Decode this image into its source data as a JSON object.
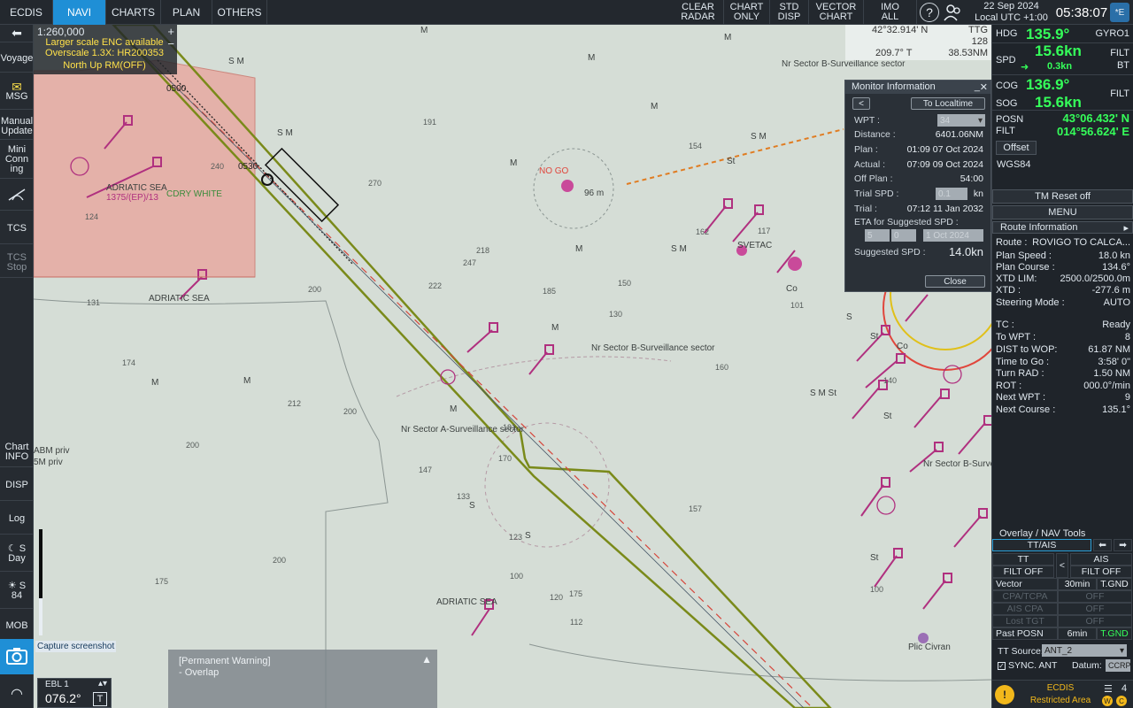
{
  "topbar": {
    "tabs": [
      "ECDIS",
      "NAVI",
      "CHARTS",
      "PLAN",
      "OTHERS"
    ],
    "active_tab": "NAVI",
    "clear_radar": [
      "CLEAR",
      "RADAR"
    ],
    "chart_only": [
      "CHART",
      "ONLY"
    ],
    "std_disp": [
      "STD",
      "DISP"
    ],
    "vector_chart": [
      "VECTOR",
      "CHART"
    ],
    "imo_all": [
      "IMO",
      "ALL"
    ],
    "help_icon": "?",
    "date": "22 Sep 2024",
    "utc": "Local UTC +1:00",
    "time": "05:38:07",
    "e_label": "*E"
  },
  "lefttb": {
    "voyage": "Voyage",
    "msg": "MSG",
    "manual_update": [
      "Manual",
      "Update"
    ],
    "mini_conning": [
      "Mini",
      "Conn",
      "ing"
    ],
    "tcs": "TCS",
    "tcs_stop": [
      "TCS",
      "Stop"
    ],
    "chart_info": [
      "Chart",
      "INFO"
    ],
    "disp": "DISP",
    "log": "Log",
    "day": "Day",
    "s_label": "S",
    "brightness": "84",
    "mob": "MOB"
  },
  "scale": {
    "value": "1:260,000",
    "warn1": "Larger scale ENC available",
    "warn2": "Overscale 1.3X: HR200353",
    "warn3": "North  Up RM(OFF)"
  },
  "cursor": {
    "lat": "42°32.914' N",
    "ttg_label": "TTG",
    "brg": "209.7° T",
    "dist": "38.53NM",
    "extra": "128"
  },
  "monitor": {
    "title": "Monitor Information",
    "back": "<",
    "to_localtime": "To Localtime",
    "wpt_label": "WPT :",
    "wpt_value": "34",
    "distance_label": "Distance :",
    "distance_value": "6401.06NM",
    "plan_label": "Plan :",
    "plan_value": "01:09 07 Oct 2024",
    "actual_label": "Actual :",
    "actual_value": "07:09 09 Oct 2024",
    "offplan_label": "Off Plan :",
    "offplan_value": "54:00",
    "trialspd_label": "Trial SPD :",
    "trialspd_value": "0.1",
    "trialspd_unit": "kn",
    "trial_label": "Trial :",
    "trial_value": "07:12 11 Jan 2032",
    "eta_label": "ETA for Suggested SPD :",
    "eta_h": "5",
    "eta_m": "0",
    "eta_date": "1 Oct 2024",
    "sugg_label": "Suggested SPD :",
    "sugg_value": "14.0kn",
    "close": "Close"
  },
  "nav": {
    "hdg_label": "HDG",
    "hdg": "135.9°",
    "hdg_src": "GYRO1",
    "spd_label": "SPD",
    "spd": "15.6kn",
    "spd_rate": "0.3kn",
    "spd_src": [
      "FILT",
      "BT"
    ],
    "cog_label": "COG",
    "cog": "136.9°",
    "sog_label": "SOG",
    "sog": "15.6kn",
    "cog_src": "FILT",
    "posn_label": "POSN",
    "filt_label": "FILT",
    "lat": "43°06.432' N",
    "lon": "014°56.624' E",
    "offset": "Offset",
    "datum": "WGS84",
    "tm_reset": "TM Reset off",
    "menu": "MENU"
  },
  "route": {
    "title": "Route Information",
    "rows": [
      {
        "l": "Route :",
        "v": "ROVIGO TO CALCA..."
      },
      {
        "l": "Plan Speed :",
        "v": "18.0 kn"
      },
      {
        "l": "Plan Course :",
        "v": "134.6°"
      },
      {
        "l": "XTD LIM:",
        "v": "2500.0/2500.0m"
      },
      {
        "l": "XTD :",
        "v": "-277.6 m"
      },
      {
        "l": "Steering Mode :",
        "v": "AUTO"
      },
      {
        "l": "TC :",
        "v": "Ready"
      },
      {
        "l": "To WPT :",
        "v": "8"
      },
      {
        "l": "DIST to WOP:",
        "v": "61.87 NM"
      },
      {
        "l": "Time to Go :",
        "v": "3:58' 0\""
      },
      {
        "l": "Turn RAD :",
        "v": "1.50 NM"
      },
      {
        "l": "ROT :",
        "v": "000.0°/min"
      },
      {
        "l": "Next WPT :",
        "v": "9"
      },
      {
        "l": "Next Course :",
        "v": "135.1°"
      }
    ]
  },
  "tools": {
    "title": "Overlay / NAV Tools",
    "tab": "TT/AIS",
    "tt": "TT",
    "ais": "AIS",
    "swap": "<",
    "tt_filt": "FILT OFF",
    "ais_filt": "FILT OFF",
    "vector": "Vector",
    "vector_val": "30min",
    "vector_mode": "T.GND",
    "cpa": "CPA/TCPA",
    "cpa_val": "OFF",
    "ais_cpa": "AIS CPA",
    "ais_cpa_val": "OFF",
    "lost_tgt": "Lost TGT",
    "lost_val": "OFF",
    "past_posn": "Past POSN",
    "past_val": "6min",
    "past_mode": "T.GND",
    "tt_source": "TT Source:",
    "tt_source_val": "ANT_2",
    "sync_ant": "SYNC. ANT",
    "datum": "Datum:",
    "datum_val": "CCRP"
  },
  "alert": {
    "line1": "ECDIS",
    "line2": "Restricted Area",
    "count": "4"
  },
  "warning": {
    "title": "[Permanent Warning]",
    "text": "- Overlap"
  },
  "ebl": {
    "label": "EBL 1",
    "value": "076.2°",
    "mode": "T"
  },
  "capture_tip": "Capture screenshot",
  "chart_labels": {
    "adriatic_sea": "ADRIATIC SEA",
    "restricted_ref": "1375/(EP)/13",
    "cdry": "CDRY WHITE",
    "sector_a": "Nr Sector A-Surveillance sector",
    "sector_b": "Nr Sector B-Surveillance sector",
    "no_go": "NO GO",
    "svetac": "SVETAC",
    "plic": "Plic Civran",
    "pal": "ABM priv",
    "pal2": "5M priv",
    "m": "M",
    "sm": "S M",
    "s": "S",
    "st": "St",
    "co": "Co",
    "sbst": "S M St",
    "ten_m": "96 m",
    "wp_0500": "0500",
    "wp_0530": "0530",
    "depth_values": [
      "191",
      "240",
      "270",
      "218",
      "247",
      "200",
      "222",
      "185",
      "130",
      "212",
      "200",
      "124",
      "131",
      "174",
      "200",
      "181",
      "170",
      "133",
      "147",
      "175",
      "123",
      "157",
      "200",
      "175",
      "120",
      "112",
      "100",
      "117",
      "154",
      "162",
      "100",
      "101",
      "150",
      "160",
      "140"
    ]
  },
  "colors": {
    "accent": "#1f8fd6",
    "green": "#35ff5a",
    "restricted": "#e58a80",
    "route": "#6e7a18",
    "magenta": "#b0307f"
  }
}
